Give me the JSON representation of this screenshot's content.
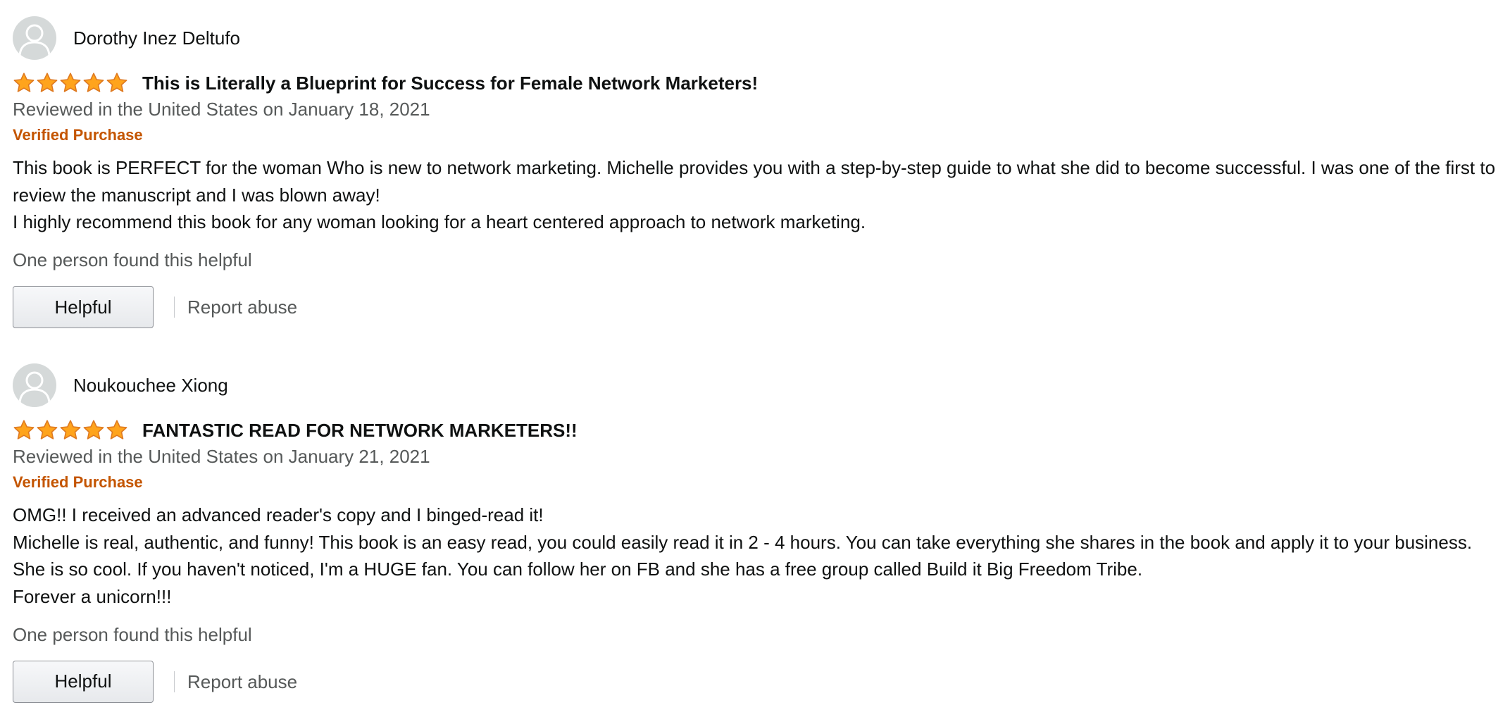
{
  "colors": {
    "verified": "#c45500",
    "secondary_text": "#565959",
    "primary_text": "#0f1111",
    "star_fill": "#ffa41c",
    "star_stroke": "#de7921",
    "avatar_bg": "#d5d9d9"
  },
  "reviews": [
    {
      "reviewer": "Dorothy Inez Deltufo",
      "rating": 5,
      "rating_icon": "five-star-rating-icon",
      "title": "This is Literally a Blueprint for Success for Female Network Marketers!",
      "date_line": "Reviewed in the United States on January 18, 2021",
      "verified": "Verified Purchase",
      "body": [
        "This book is PERFECT for the woman Who is new to network marketing. Michelle provides you with a step-by-step guide to what she did to become successful. I was one of the first to review the manuscript and I was blown away!",
        "I highly recommend this book for any woman looking for a heart centered approach to network marketing."
      ],
      "helpful_count": "One person found this helpful",
      "helpful_button": "Helpful",
      "report": "Report abuse"
    },
    {
      "reviewer": "Noukouchee Xiong",
      "rating": 5,
      "rating_icon": "five-star-rating-icon",
      "title": "FANTASTIC READ FOR NETWORK MARKETERS!!",
      "date_line": "Reviewed in the United States on January 21, 2021",
      "verified": "Verified Purchase",
      "body": [
        "OMG!! I received an advanced reader's copy and I binged-read it!",
        "Michelle is real, authentic, and funny! This book is an easy read, you could easily read it in 2 - 4 hours. You can take everything she shares in the book and apply it to your business. She is so cool. If you haven't noticed, I'm a HUGE fan. You can follow her on FB and she has a free group called Build it Big Freedom Tribe.",
        "Forever a unicorn!!!"
      ],
      "helpful_count": "One person found this helpful",
      "helpful_button": "Helpful",
      "report": "Report abuse"
    }
  ]
}
